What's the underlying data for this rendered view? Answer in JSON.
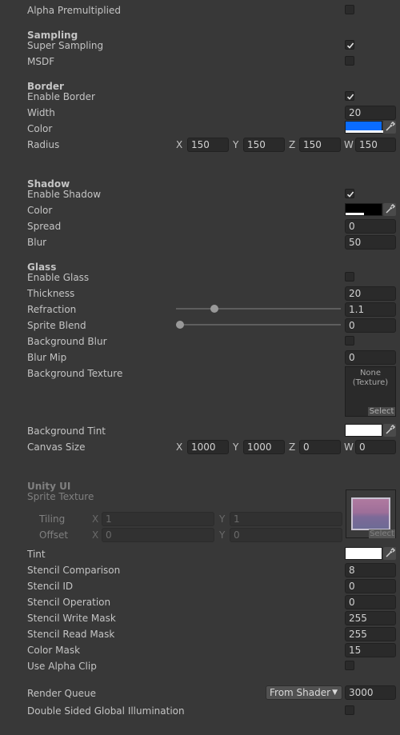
{
  "alpha_premultiplied": {
    "label": "Alpha Premultiplied",
    "checked": false
  },
  "sampling": {
    "header": "Sampling",
    "super_sampling": {
      "label": "Super Sampling",
      "checked": true
    },
    "msdf": {
      "label": "MSDF",
      "checked": false
    }
  },
  "border": {
    "header": "Border",
    "enable": {
      "label": "Enable Border",
      "checked": true
    },
    "width": {
      "label": "Width",
      "value": "20"
    },
    "color": {
      "label": "Color",
      "hex": "#0a6cff"
    },
    "radius": {
      "label": "Radius",
      "x_axis": "X",
      "x": "150",
      "y_axis": "Y",
      "y": "150",
      "z_axis": "Z",
      "z": "150",
      "w_axis": "W",
      "w": "150"
    }
  },
  "shadow": {
    "header": "Shadow",
    "enable": {
      "label": "Enable Shadow",
      "checked": true
    },
    "color": {
      "label": "Color",
      "hex": "#000000"
    },
    "spread": {
      "label": "Spread",
      "value": "0"
    },
    "blur": {
      "label": "Blur",
      "value": "50"
    }
  },
  "glass": {
    "header": "Glass",
    "enable": {
      "label": "Enable Glass",
      "checked": false
    },
    "thickness": {
      "label": "Thickness",
      "value": "20"
    },
    "refraction": {
      "label": "Refraction",
      "value": "1.1",
      "fraction": 0.21
    },
    "sprite_blend": {
      "label": "Sprite Blend",
      "value": "0",
      "fraction": 0.0
    },
    "background_blur": {
      "label": "Background Blur",
      "checked": false
    },
    "blur_mip": {
      "label": "Blur Mip",
      "value": "0"
    },
    "background_texture": {
      "label": "Background Texture",
      "slot_text_1": "None",
      "slot_text_2": "(Texture)",
      "select": "Select"
    },
    "background_tint": {
      "label": "Background Tint",
      "hex": "#ffffff"
    },
    "canvas_size": {
      "label": "Canvas Size",
      "x_axis": "X",
      "x": "1000",
      "y_axis": "Y",
      "y": "1000",
      "z_axis": "Z",
      "z": "0",
      "w_axis": "W",
      "w": "0"
    }
  },
  "unity_ui": {
    "header": "Unity UI",
    "sprite_texture": {
      "label": "Sprite Texture",
      "select": "Select"
    },
    "tiling": {
      "label": "Tiling",
      "x_axis": "X",
      "x": "1",
      "y_axis": "Y",
      "y": "1"
    },
    "offset": {
      "label": "Offset",
      "x_axis": "X",
      "x": "0",
      "y_axis": "Y",
      "y": "0"
    },
    "tint": {
      "label": "Tint",
      "hex": "#ffffff"
    },
    "stencil_comparison": {
      "label": "Stencil Comparison",
      "value": "8"
    },
    "stencil_id": {
      "label": "Stencil ID",
      "value": "0"
    },
    "stencil_operation": {
      "label": "Stencil Operation",
      "value": "0"
    },
    "stencil_write_mask": {
      "label": "Stencil Write Mask",
      "value": "255"
    },
    "stencil_read_mask": {
      "label": "Stencil Read Mask",
      "value": "255"
    },
    "color_mask": {
      "label": "Color Mask",
      "value": "15"
    },
    "use_alpha_clip": {
      "label": "Use Alpha Clip",
      "checked": false
    }
  },
  "render_queue": {
    "label": "Render Queue",
    "mode": "From Shader",
    "value": "3000"
  },
  "double_sided_gi": {
    "label": "Double Sided Global Illumination",
    "checked": false
  }
}
